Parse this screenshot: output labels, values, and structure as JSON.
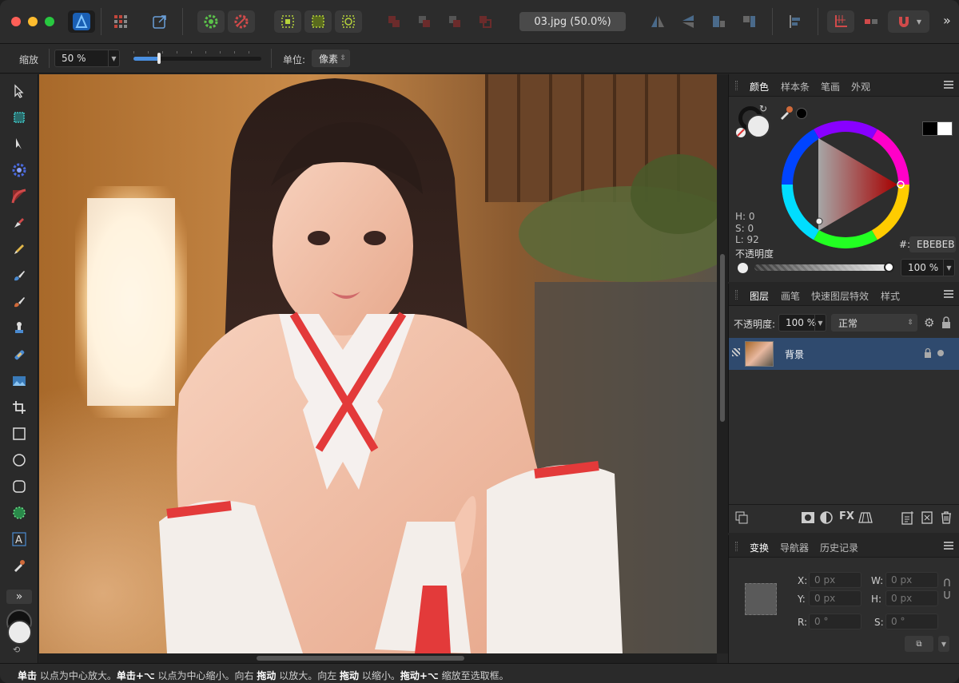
{
  "titlebar": {
    "document_title": "03.jpg (50.0%)",
    "overflow_label": "»"
  },
  "context": {
    "zoom_label": "缩放",
    "zoom_value": "50 %",
    "unit_label": "单位:",
    "unit_value": "像素",
    "zoom_slider_level": 0.2
  },
  "toolbar": {
    "expand_label": "»"
  },
  "color_panel": {
    "tabs": [
      "颜色",
      "样本条",
      "笔画",
      "外观"
    ],
    "h": "H: 0",
    "s": "S: 0",
    "l": "L: 92",
    "hex_label": "#:",
    "hex_value": "EBEBEB",
    "opacity_label": "不透明度",
    "opacity_value": "100 %",
    "fill_color": "#EBEBEB"
  },
  "layers_panel": {
    "tabs": [
      "图层",
      "画笔",
      "快速图层特效",
      "样式"
    ],
    "opacity_label": "不透明度:",
    "opacity_value": "100 %",
    "blend_mode": "正常",
    "layers": [
      {
        "name": "背景"
      }
    ]
  },
  "transform_panel": {
    "tabs": [
      "变换",
      "导航器",
      "历史记录"
    ],
    "x_label": "X:",
    "x_value": "0 px",
    "y_label": "Y:",
    "y_value": "0 px",
    "w_label": "W:",
    "w_value": "0 px",
    "h_label": "H:",
    "h_value": "0 px",
    "r_label": "R:",
    "r_value": "0 °",
    "s_label": "S:",
    "s_value": "0 °"
  },
  "status": {
    "t1": "单击",
    "t2": " 以点为中心放大。",
    "t3": "单击+⌥",
    "t4": " 以点为中心缩小。向右 ",
    "t5": "拖动",
    "t6": " 以放大。向左 ",
    "t7": "拖动",
    "t8": " 以缩小。",
    "t9": "拖动+⌥",
    "t10": " 缩放至选取框。"
  },
  "colors": {
    "accent": "#2f7bd6",
    "selected_layer": "#2f4a6e",
    "red_close": "#fe5f57",
    "yellow_min": "#febc2e",
    "green_max": "#28c840"
  }
}
